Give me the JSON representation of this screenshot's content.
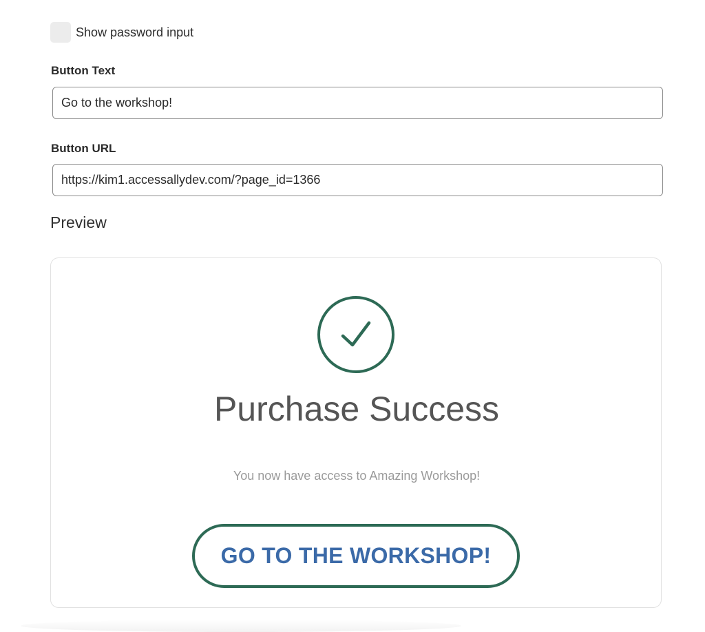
{
  "options": {
    "show_password_label": "Show password input",
    "show_password_checked": false
  },
  "button_text_field": {
    "label": "Button Text",
    "value": "Go to the workshop!"
  },
  "button_url_field": {
    "label": "Button URL",
    "value": "https://kim1.accessallydev.com/?page_id=1366"
  },
  "preview": {
    "heading": "Preview",
    "title": "Purchase Success",
    "message": "You now have access to Amazing Workshop!",
    "button_label": "GO TO THE WORKSHOP!",
    "icon": "checkmark-circle-icon"
  },
  "colors": {
    "accent_green": "#2d6a55",
    "button_text_blue": "#3b6aa8"
  }
}
